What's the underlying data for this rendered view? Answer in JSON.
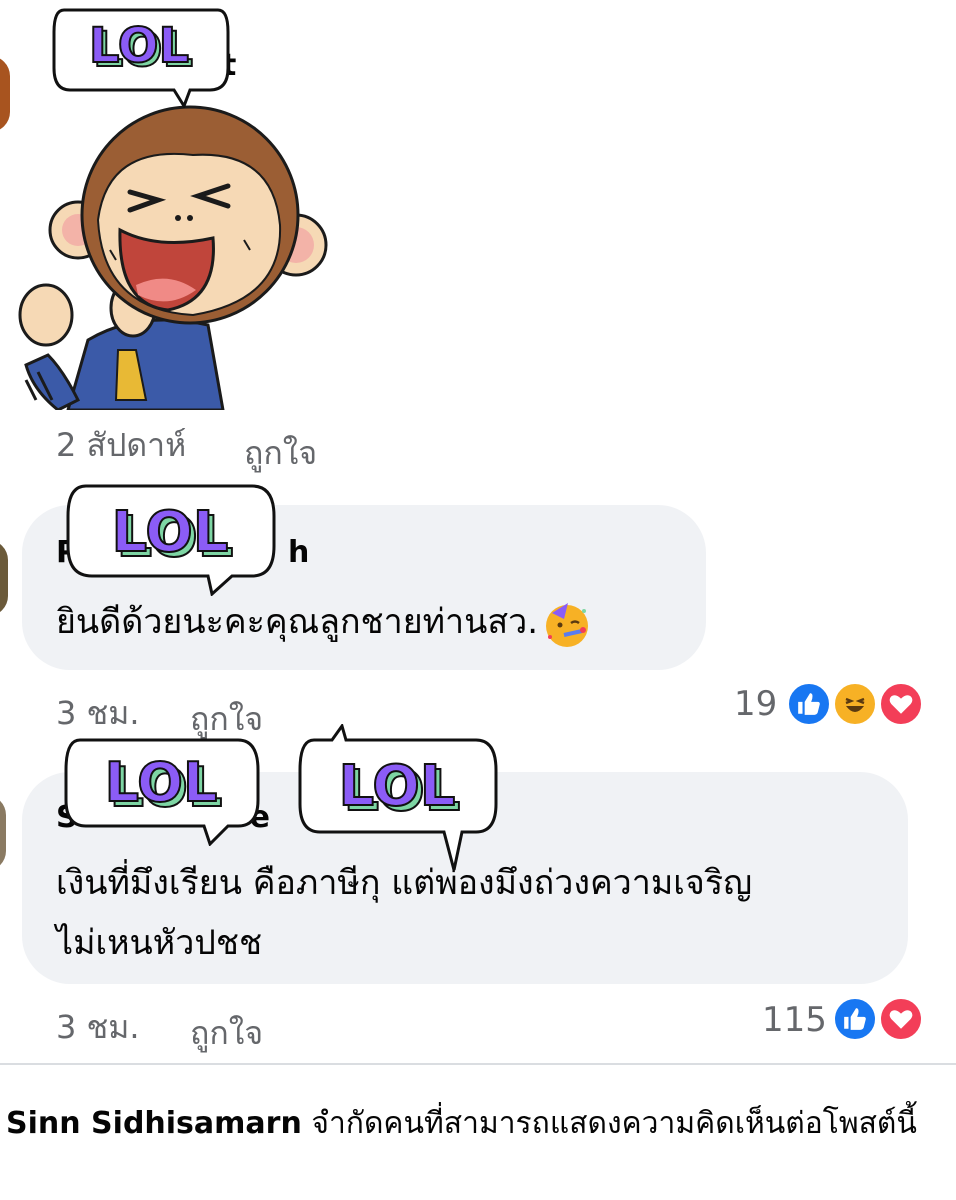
{
  "comments": [
    {
      "author": "t",
      "time": "2 สัปดาห์",
      "like_label": "ถูกใจ"
    },
    {
      "author": "h",
      "text": "ยินดีด้วยนะคะคุณลูกชายท่านสว.",
      "time": "3 ชม.",
      "like_label": "ถูกใจ",
      "reaction_count": "19"
    },
    {
      "author_parts": [
        "S",
        "e",
        "k"
      ],
      "text_line1": "เงินที่มึงเรียน คือภาษีกุ แต่พ่องมึงถ่วงความเจริญ",
      "text_line2": "ไม่เหนหัวปชช",
      "time": "3 ชม.",
      "like_label": "ถูกใจ",
      "reaction_count": "115"
    }
  ],
  "stickers": {
    "lol_text": "LOL"
  },
  "footer": {
    "name": "Sinn Sidhisamarn",
    "notice": "จำกัดคนที่สามารถแสดงความคิดเห็นต่อโพสต์นี้"
  },
  "colors": {
    "like_blue": "#1877f2",
    "haha_yellow": "#f7b125",
    "love_red": "#f33e58",
    "bubble_bg": "#f0f2f5",
    "meta_gray": "#65676b",
    "lol_purple": "#8b5cf6",
    "lol_green": "#7ed6a4"
  }
}
